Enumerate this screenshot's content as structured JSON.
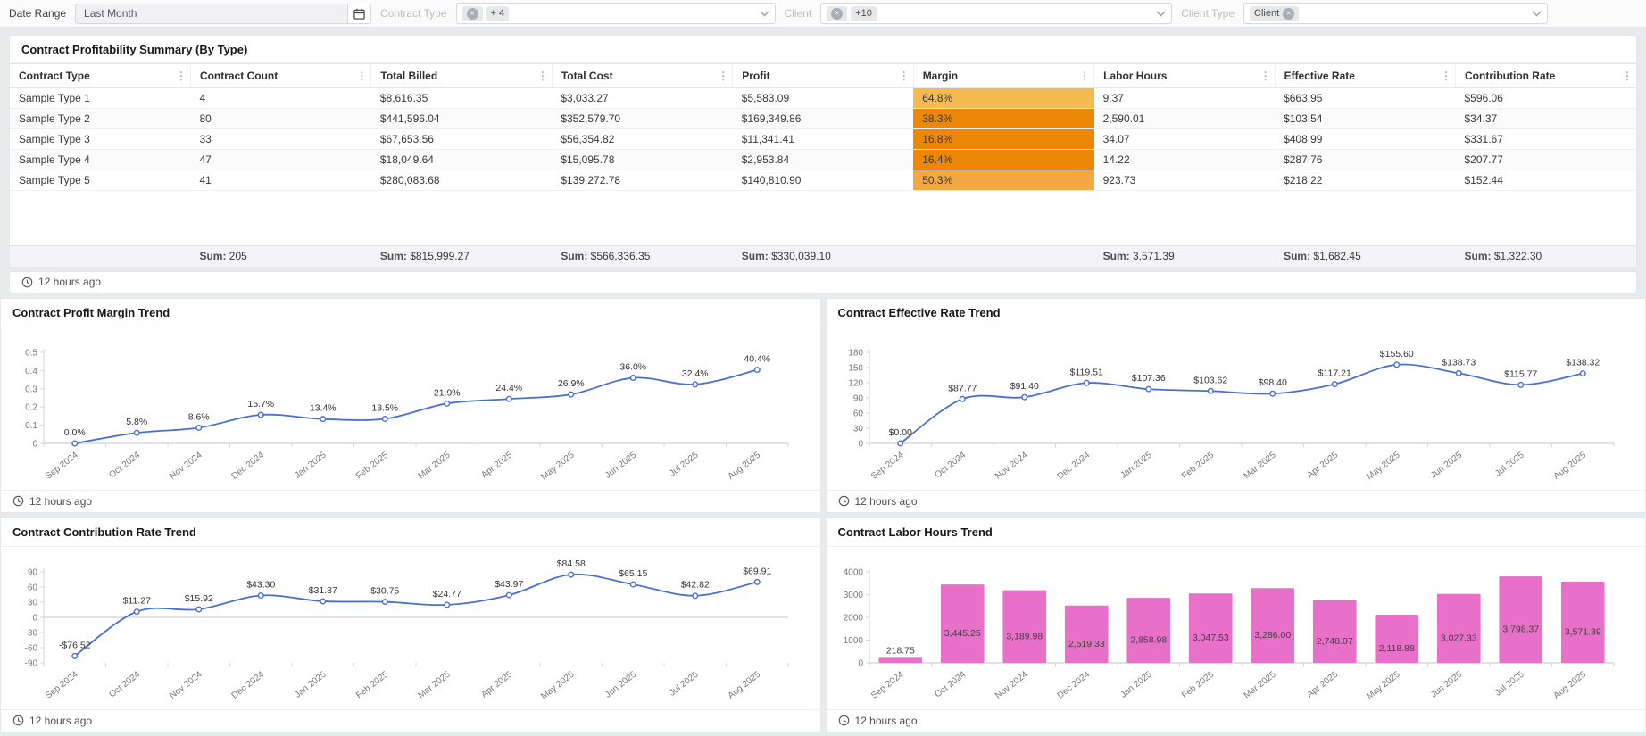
{
  "filters": {
    "date_range_label": "Date Range",
    "date_range_value": "Last Month",
    "contract_type_label": "Contract Type",
    "contract_type_more": "+ 4",
    "client_label": "Client",
    "client_more": "+10",
    "client_type_label": "Client Type",
    "client_type_tag": "Client"
  },
  "icons": {
    "remove": "✕",
    "kebab": "⋮"
  },
  "summary": {
    "title": "Contract Profitability Summary (By Type)",
    "updated": "12 hours ago",
    "columns": [
      "Contract Type",
      "Contract Count",
      "Total Billed",
      "Total Cost",
      "Profit",
      "Margin",
      "Labor Hours",
      "Effective Rate",
      "Contribution Rate"
    ],
    "margin_col_index": 5,
    "rows": [
      {
        "cells": [
          "Sample Type 1",
          "4",
          "$8,616.35",
          "$3,033.27",
          "$5,583.09",
          "64.8%",
          "9.37",
          "$663.95",
          "$596.06"
        ],
        "margin_color": "#f6ba52"
      },
      {
        "cells": [
          "Sample Type 2",
          "80",
          "$441,596.04",
          "$352,579.70",
          "$169,349.86",
          "38.3%",
          "2,590.01",
          "$103.54",
          "$34.37"
        ],
        "margin_color": "#ee8606"
      },
      {
        "cells": [
          "Sample Type 3",
          "33",
          "$67,653.56",
          "$56,354.82",
          "$11,341.41",
          "16.8%",
          "34.07",
          "$408.99",
          "$331.67"
        ],
        "margin_color": "#ee8606"
      },
      {
        "cells": [
          "Sample Type 4",
          "47",
          "$18,049.64",
          "$15,095.78",
          "$2,953.84",
          "16.4%",
          "14.22",
          "$287.76",
          "$207.77"
        ],
        "margin_color": "#ee8606"
      },
      {
        "cells": [
          "Sample Type 5",
          "41",
          "$280,083.68",
          "$139,272.78",
          "$140,810.90",
          "50.3%",
          "923.73",
          "$218.22",
          "$152.44"
        ],
        "margin_color": "#f4a843"
      }
    ],
    "sum_label": "Sum:",
    "sums": [
      null,
      "205",
      "$815,999.27",
      "$566,336.35",
      "$330,039.10",
      null,
      "3,571.39",
      "$1,682.45",
      "$1,322.30"
    ]
  },
  "panels": [
    {
      "title": "Contract Profit Margin Trend",
      "updated": "12 hours ago"
    },
    {
      "title": "Contract Effective Rate Trend",
      "updated": "12 hours ago"
    },
    {
      "title": "Contract Contribution Rate Trend",
      "updated": "12 hours ago"
    },
    {
      "title": "Contract Labor Hours Trend",
      "updated": "12 hours ago"
    }
  ],
  "chart_data": [
    {
      "type": "line",
      "title": "Contract Profit Margin Trend",
      "categories": [
        "Sep 2024",
        "Oct 2024",
        "Nov 2024",
        "Dec 2024",
        "Jan 2025",
        "Feb 2025",
        "Mar 2025",
        "Apr 2025",
        "May 2025",
        "Jun 2025",
        "Jul 2025",
        "Aug 2025"
      ],
      "values": [
        0.0,
        0.058,
        0.086,
        0.157,
        0.134,
        0.135,
        0.219,
        0.244,
        0.269,
        0.36,
        0.324,
        0.404
      ],
      "labels": [
        "0.0%",
        "5.8%",
        "8.6%",
        "15.7%",
        "13.4%",
        "13.5%",
        "21.9%",
        "24.4%",
        "26.9%",
        "36.0%",
        "32.4%",
        "40.4%"
      ],
      "ylim": [
        0,
        0.5
      ],
      "yticks": [
        0,
        0.1,
        0.2,
        0.3,
        0.4,
        0.5
      ],
      "ytick_labels": [
        "0",
        "0.1",
        "0.2",
        "0.3",
        "0.4",
        "0.5"
      ],
      "xlabel": "",
      "ylabel": "",
      "grid": false,
      "legend": "none"
    },
    {
      "type": "line",
      "title": "Contract Effective Rate Trend",
      "categories": [
        "Sep 2024",
        "Oct 2024",
        "Nov 2024",
        "Dec 2024",
        "Jan 2025",
        "Feb 2025",
        "Mar 2025",
        "Apr 2025",
        "May 2025",
        "Jun 2025",
        "Jul 2025",
        "Aug 2025"
      ],
      "values": [
        0,
        87.77,
        91.4,
        119.51,
        107.36,
        103.62,
        98.4,
        117.21,
        155.6,
        138.73,
        115.77,
        138.32
      ],
      "labels": [
        "$0.00",
        "$87.77",
        "$91.40",
        "$119.51",
        "$107.36",
        "$103.62",
        "$98.40",
        "$117.21",
        "$155.60",
        "$138.73",
        "$115.77",
        "$138.32"
      ],
      "ylim": [
        0,
        180
      ],
      "yticks": [
        0,
        30,
        60,
        90,
        120,
        150,
        180
      ],
      "ytick_labels": [
        "0",
        "30",
        "60",
        "90",
        "120",
        "150",
        "180"
      ],
      "xlabel": "",
      "ylabel": "",
      "grid": false,
      "legend": "none"
    },
    {
      "type": "line",
      "title": "Contract Contribution Rate Trend",
      "categories": [
        "Sep 2024",
        "Oct 2024",
        "Nov 2024",
        "Dec 2024",
        "Jan 2025",
        "Feb 2025",
        "Mar 2025",
        "Apr 2025",
        "May 2025",
        "Jun 2025",
        "Jul 2025",
        "Aug 2025"
      ],
      "values": [
        -76.52,
        11.27,
        15.92,
        43.3,
        31.87,
        30.75,
        24.77,
        43.97,
        84.58,
        65.15,
        42.82,
        69.91
      ],
      "labels": [
        "-$76.52",
        "$11.27",
        "$15.92",
        "$43.30",
        "$31.87",
        "$30.75",
        "$24.77",
        "$43.97",
        "$84.58",
        "$65.15",
        "$42.82",
        "$69.91"
      ],
      "ylim": [
        -90,
        90
      ],
      "yticks": [
        -90,
        -60,
        -30,
        0,
        30,
        60,
        90
      ],
      "ytick_labels": [
        "-90",
        "-60",
        "-30",
        "0",
        "30",
        "60",
        "90"
      ],
      "xlabel": "",
      "ylabel": "",
      "grid": false,
      "legend": "none"
    },
    {
      "type": "bar",
      "title": "Contract Labor Hours Trend",
      "categories": [
        "Sep 2024",
        "Oct 2024",
        "Nov 2024",
        "Dec 2024",
        "Jan 2025",
        "Feb 2025",
        "Mar 2025",
        "Apr 2025",
        "May 2025",
        "Jun 2025",
        "Jul 2025",
        "Aug 2025"
      ],
      "values": [
        218.75,
        3445.25,
        3189.98,
        2519.33,
        2858.98,
        3047.53,
        3286.0,
        2748.07,
        2118.88,
        3027.33,
        3798.37,
        3571.39
      ],
      "labels": [
        "218.75",
        "3,445.25",
        "3,189.98",
        "2,519.33",
        "2,858.98",
        "3,047.53",
        "3,286.00",
        "2,748.07",
        "2,118.88",
        "3,027.33",
        "3,798.37",
        "3,571.39"
      ],
      "ylim": [
        0,
        4000
      ],
      "yticks": [
        0,
        1000,
        2000,
        3000,
        4000
      ],
      "ytick_labels": [
        "0",
        "1000",
        "2000",
        "3000",
        "4000"
      ],
      "xlabel": "",
      "ylabel": "",
      "grid": false,
      "legend": "none"
    }
  ],
  "colors": {
    "line": "#4a6fd4",
    "bar": "#e870c8",
    "axis": "#d4d5d8",
    "zero_line": "#cfd0d3",
    "tick_text": "#76777c",
    "label_text": "#333333",
    "bar_label": "#414141",
    "margin_high": "#f6ba52",
    "margin_low": "#ee8606"
  }
}
